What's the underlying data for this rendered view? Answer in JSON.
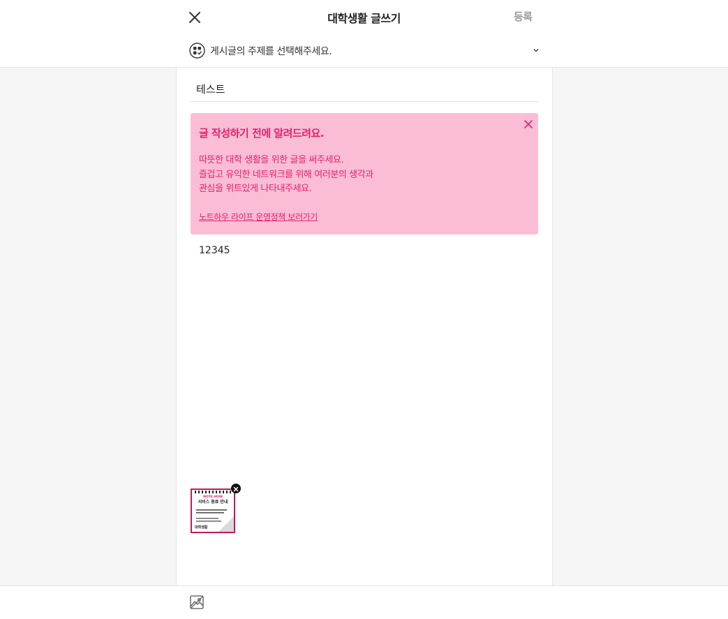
{
  "header": {
    "title": "대학생활 글쓰기",
    "register_label": "등록",
    "close_icon": "close-icon"
  },
  "topic_select": {
    "placeholder": "게시글의 주제를 선택해주세요.",
    "icon": "topic-icon",
    "chevron_icon": "chevron-down-icon"
  },
  "editor": {
    "title_value": "테스트",
    "body_text": "12345"
  },
  "notice": {
    "title": "글 작성하기 전에 알려드려요.",
    "lines": [
      "따뜻한 대학 생활을 위한 글을 써주세요.",
      "즐겁고 유익한 네트워크를 위해 여러분의 생각과",
      "관심을 위트있게 나타내주세요."
    ],
    "link": "노트하우 라이프 운영정책 보러가기",
    "close_icon": "close-icon"
  },
  "attachment": {
    "brand": "NOTE HOW",
    "heading": "서비스 종료 안내",
    "badge": "대학생활",
    "remove_icon": "remove-icon"
  },
  "toolbar": {
    "image_icon": "image-icon"
  },
  "colors": {
    "accent": "#e3226c",
    "notice_bg": "#fbbdd6",
    "muted": "#9a9a9a",
    "page_bg": "#f5f5f5"
  }
}
